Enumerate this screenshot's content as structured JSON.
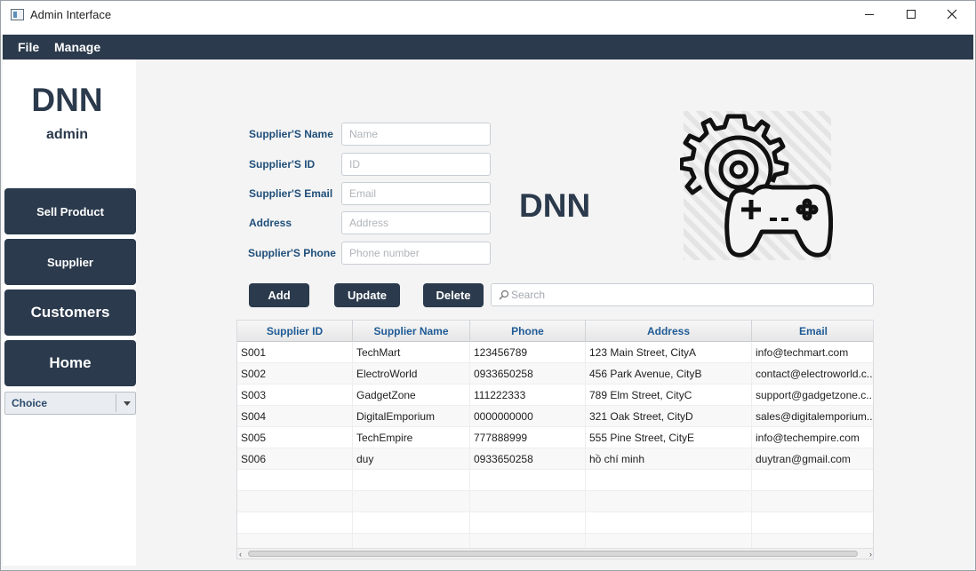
{
  "window": {
    "title": "Admin Interface"
  },
  "menu": {
    "items": [
      "File",
      "Manage"
    ]
  },
  "sidebar": {
    "brand": "DNN",
    "user": "admin",
    "nav": [
      "Sell Product",
      "Supplier",
      "Customers",
      "Home"
    ],
    "choice": "Choice"
  },
  "form": {
    "fields": [
      {
        "label": "Supplier'S Name",
        "placeholder": "Name"
      },
      {
        "label": "Supplier'S ID",
        "placeholder": "ID"
      },
      {
        "label": "Supplier'S Email",
        "placeholder": "Email"
      },
      {
        "label": "Address",
        "placeholder": "Address"
      },
      {
        "label": "Supplier'S Phone",
        "placeholder": "Phone number"
      }
    ]
  },
  "center_brand": "DNN",
  "actions": {
    "add": "Add",
    "update": "Update",
    "delete": "Delete",
    "search_placeholder": "Search"
  },
  "table": {
    "columns": [
      "Supplier ID",
      "Supplier Name",
      "Phone",
      "Address",
      "Email"
    ],
    "rows": [
      [
        "S001",
        "TechMart",
        "123456789",
        "123 Main Street, CityA",
        "info@techmart.com"
      ],
      [
        "S002",
        "ElectroWorld",
        "0933650258",
        "456 Park Avenue, CityB",
        "contact@electroworld.c..."
      ],
      [
        "S003",
        "GadgetZone",
        "111222333",
        "789 Elm Street, CityC",
        "support@gadgetzone.c..."
      ],
      [
        "S004",
        "DigitalEmporium",
        "0000000000",
        "321 Oak Street, CityD",
        "sales@digitalemporium...."
      ],
      [
        "S005",
        "TechEmpire",
        "777888999",
        "555 Pine Street, CityE",
        "info@techempire.com"
      ],
      [
        "S006",
        "duy",
        "0933650258",
        "hồ chí minh",
        "duytran@gmail.com"
      ]
    ]
  },
  "colors": {
    "primary": "#2b3a4c",
    "header_text": "#1f5b96",
    "label_text": "#1f4e79"
  },
  "icons": {
    "app": "app-window-icon",
    "illustration": "gear-gamepad-icon",
    "search": "search-icon"
  }
}
